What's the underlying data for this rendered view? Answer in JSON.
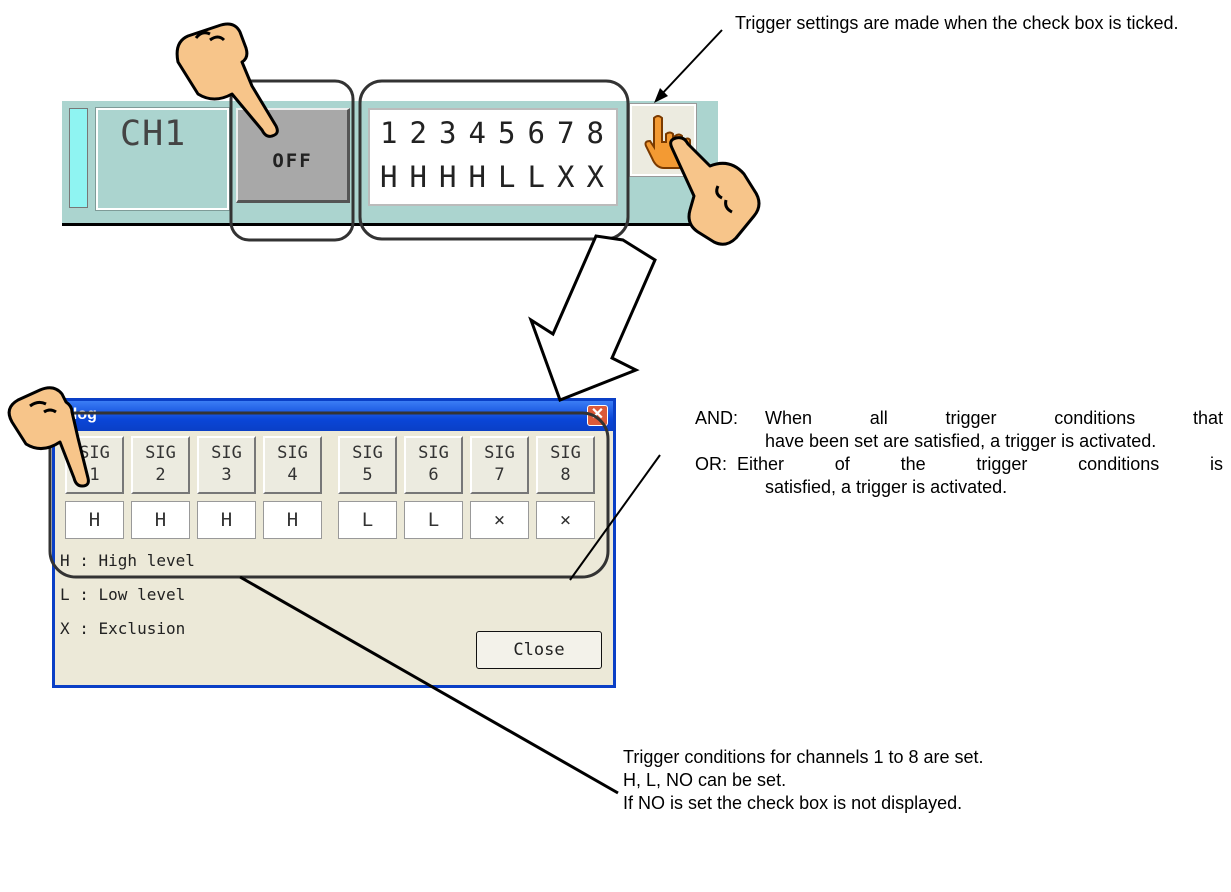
{
  "annotations": {
    "top_note": "Trigger settings are made when the check box is ticked.",
    "and_prefix": "AND:",
    "and_text_1": "When all trigger conditions that",
    "and_text_2": "have been set are satisfied, a trigger is activated.",
    "or_prefix": "OR:",
    "or_text_1": "Either of the trigger conditions is",
    "or_text_2": "satisfied, a trigger is activated.",
    "bottom_line_1": "Trigger conditions for channels 1 to 8 are set.",
    "bottom_line_2": "H, L, NO can be set.",
    "bottom_line_3": "If NO is set the check box is not displayed."
  },
  "channel_strip": {
    "channel_label": "CH1",
    "off_button": "OFF",
    "signal_numbers": [
      "1",
      "2",
      "3",
      "4",
      "5",
      "6",
      "7",
      "8"
    ],
    "signal_levels": [
      "H",
      "H",
      "H",
      "H",
      "L",
      "L",
      "X",
      "X"
    ]
  },
  "dialog": {
    "title": "alog",
    "close_glyph": "✕",
    "sig_buttons": [
      {
        "line1": "SIG",
        "line2": "1"
      },
      {
        "line1": "SIG",
        "line2": "2"
      },
      {
        "line1": "SIG",
        "line2": "3"
      },
      {
        "line1": "SIG",
        "line2": "4"
      },
      {
        "line1": "SIG",
        "line2": "5"
      },
      {
        "line1": "SIG",
        "line2": "6"
      },
      {
        "line1": "SIG",
        "line2": "7"
      },
      {
        "line1": "SIG",
        "line2": "8"
      }
    ],
    "levels": [
      "H",
      "H",
      "H",
      "H",
      "L",
      "L",
      "×",
      "×"
    ],
    "legend": [
      "H  : High level",
      "L  : Low level",
      "X  : Exclusion"
    ],
    "close_button": "Close"
  },
  "icons": {
    "pointing_hand": "pointing-hand-icon",
    "check_hand": "hand-cursor-icon"
  },
  "colors": {
    "strip_bg": "#abd4cf",
    "dialog_title": "#0a46d8",
    "hand_fill": "#f7c58a",
    "hand_outline": "#000000"
  }
}
